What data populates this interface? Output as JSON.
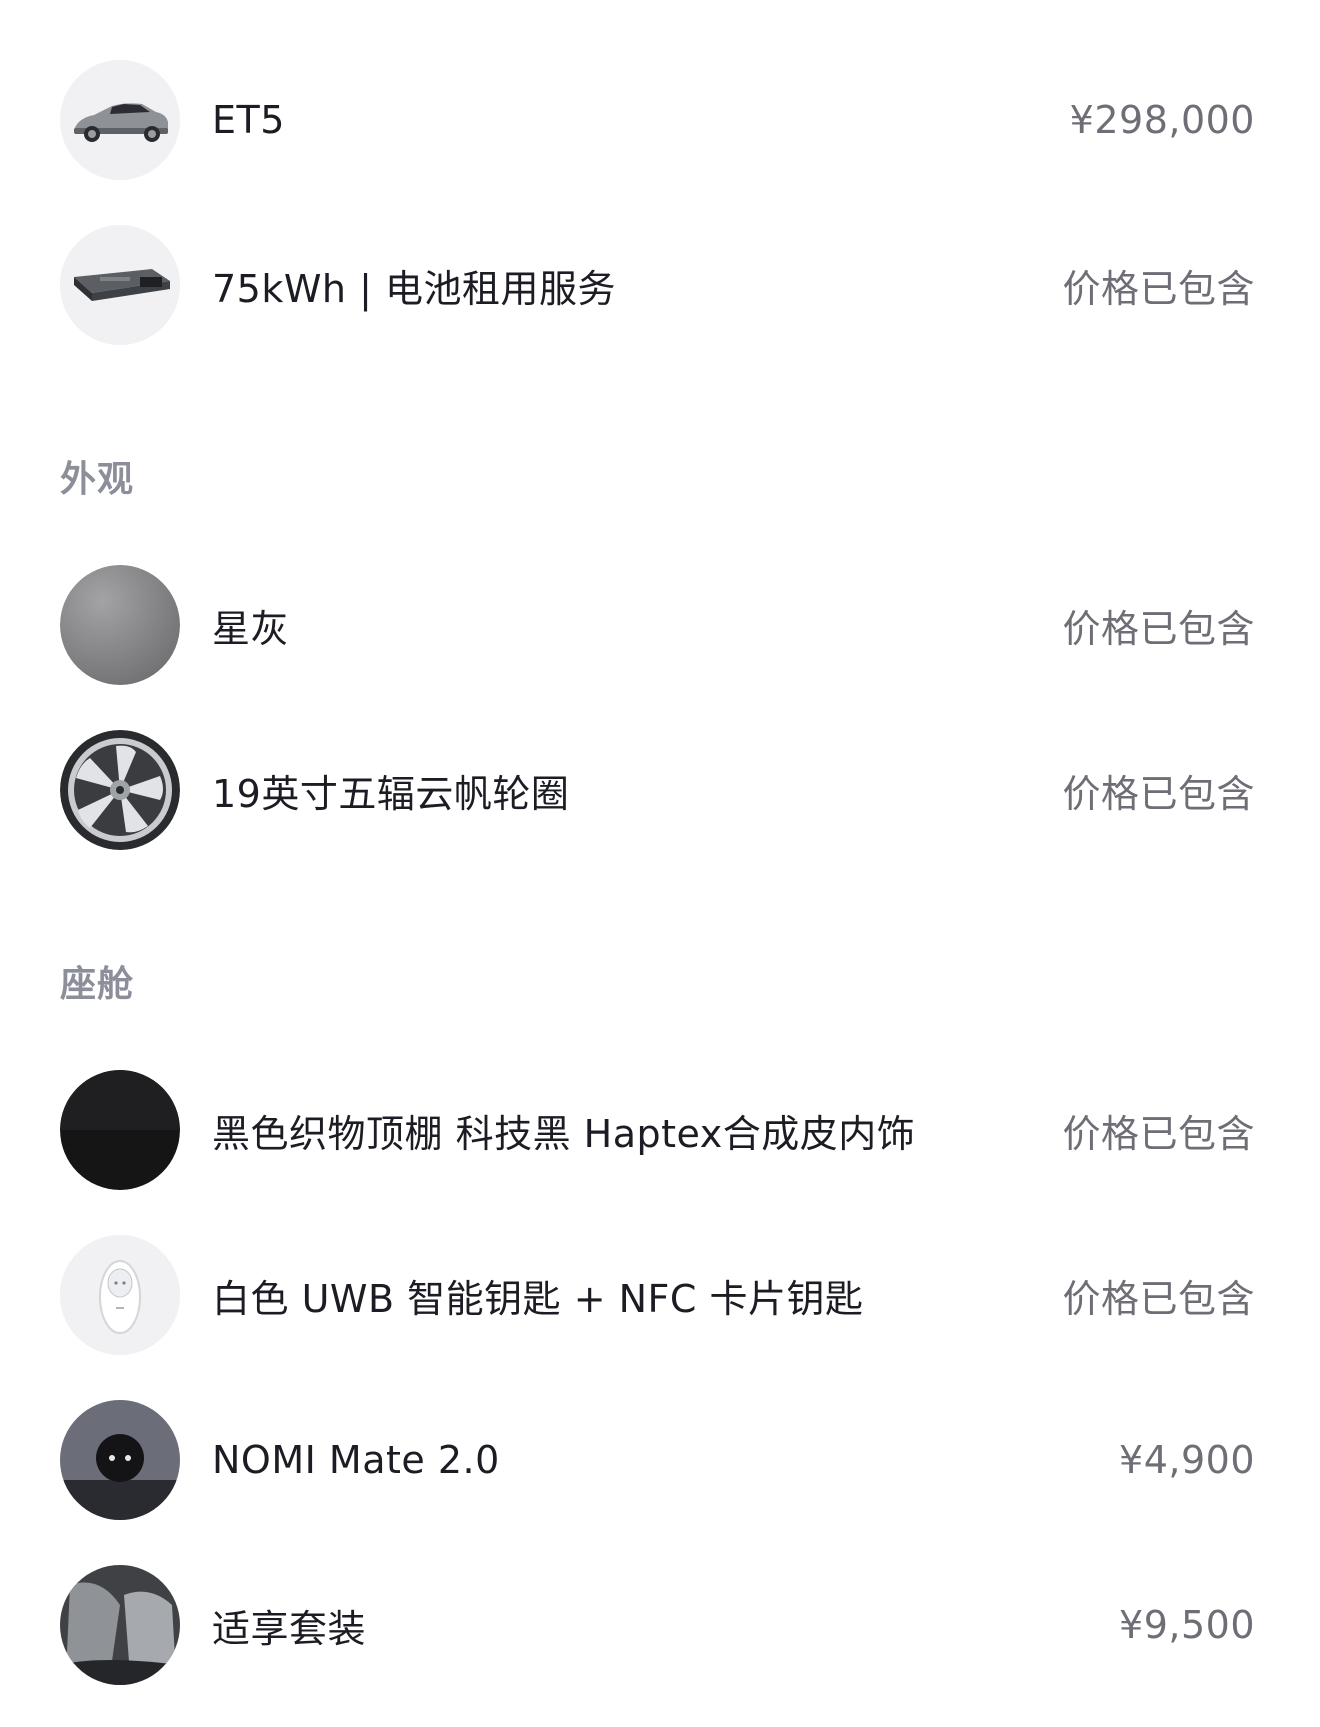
{
  "items_top": [
    {
      "name": "ET5",
      "price": "¥298,000",
      "icon": "car-icon"
    },
    {
      "name": "75kWh | 电池租用服务",
      "price": "价格已包含",
      "icon": "battery-pack-icon"
    }
  ],
  "sections": [
    {
      "title": "外观",
      "items": [
        {
          "name": "星灰",
          "price": "价格已包含",
          "icon": "color-swatch-icon"
        },
        {
          "name": "19英寸五辐云帆轮圈",
          "price": "价格已包含",
          "icon": "wheel-icon"
        }
      ]
    },
    {
      "title": "座舱",
      "items": [
        {
          "name": "黑色织物顶棚 科技黑 Haptex合成皮内饰",
          "price": "价格已包含",
          "icon": "interior-swatch-icon"
        },
        {
          "name": "白色 UWB 智能钥匙 + NFC 卡片钥匙",
          "price": "价格已包含",
          "icon": "key-fob-icon"
        },
        {
          "name": "NOMI Mate 2.0",
          "price": "¥4,900",
          "icon": "nomi-icon"
        },
        {
          "name": "适享套装",
          "price": "¥9,500",
          "icon": "seat-icon"
        }
      ]
    }
  ],
  "colors": {
    "price_gray": "#6e6e76",
    "section_gray": "#8c8e99",
    "text": "#1c1d24"
  }
}
